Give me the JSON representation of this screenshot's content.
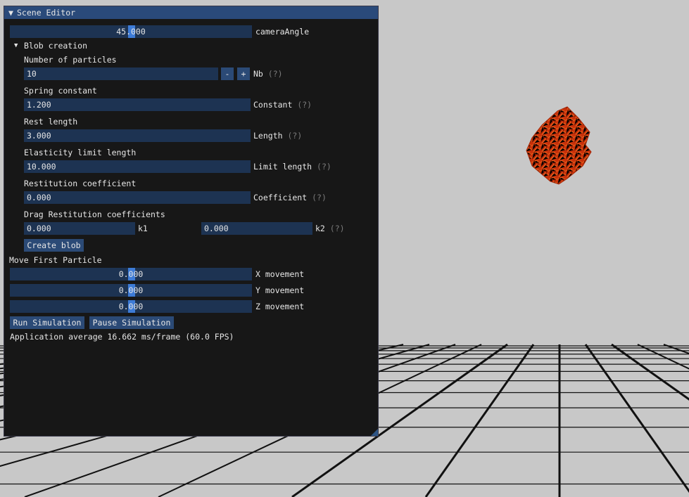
{
  "window": {
    "title": "Scene Editor"
  },
  "camera": {
    "value": "45.000",
    "label": "cameraAngle"
  },
  "blob_section": {
    "header": "Blob creation",
    "particles": {
      "title": "Number of particles",
      "value": "10",
      "minus": "-",
      "plus": "+",
      "label": "Nb",
      "help": "(?)"
    },
    "spring": {
      "title": "Spring constant",
      "value": "1.200",
      "label": "Constant",
      "help": "(?)"
    },
    "rest": {
      "title": "Rest length",
      "value": "3.000",
      "label": "Length",
      "help": "(?)"
    },
    "elasticity": {
      "title": "Elasticity limit length",
      "value": "10.000",
      "label": "Limit length",
      "help": "(?)"
    },
    "restitution": {
      "title": "Restitution coefficient",
      "value": "0.000",
      "label": "Coefficient",
      "help": "(?)"
    },
    "drag": {
      "title": "Drag Restitution coefficients",
      "k1_value": "0.000",
      "k1_label": "k1",
      "k2_value": "0.000",
      "k2_label": "k2",
      "help": "(?)"
    },
    "create_button": "Create blob"
  },
  "move_section": {
    "title": "Move First Particle",
    "x": {
      "value": "0.000",
      "label": "X movement"
    },
    "y": {
      "value": "0.000",
      "label": "Y movement"
    },
    "z": {
      "value": "0.000",
      "label": "Z movement"
    }
  },
  "simulation": {
    "run_button": "Run Simulation",
    "pause_button": "Pause Simulation"
  },
  "status": {
    "fps_text": "Application average 16.662 ms/frame (60.0 FPS)"
  },
  "colors": {
    "background": "#c8c8c8",
    "panel": "#171717",
    "titlebar": "#2a4a7a",
    "field": "#1d3352",
    "button": "#2b4a76",
    "slider_grab": "#3d7bd6",
    "blob": "#c8300a"
  },
  "icons": {
    "window_collapse": "triangle-down",
    "tree_collapse": "triangle-down"
  }
}
